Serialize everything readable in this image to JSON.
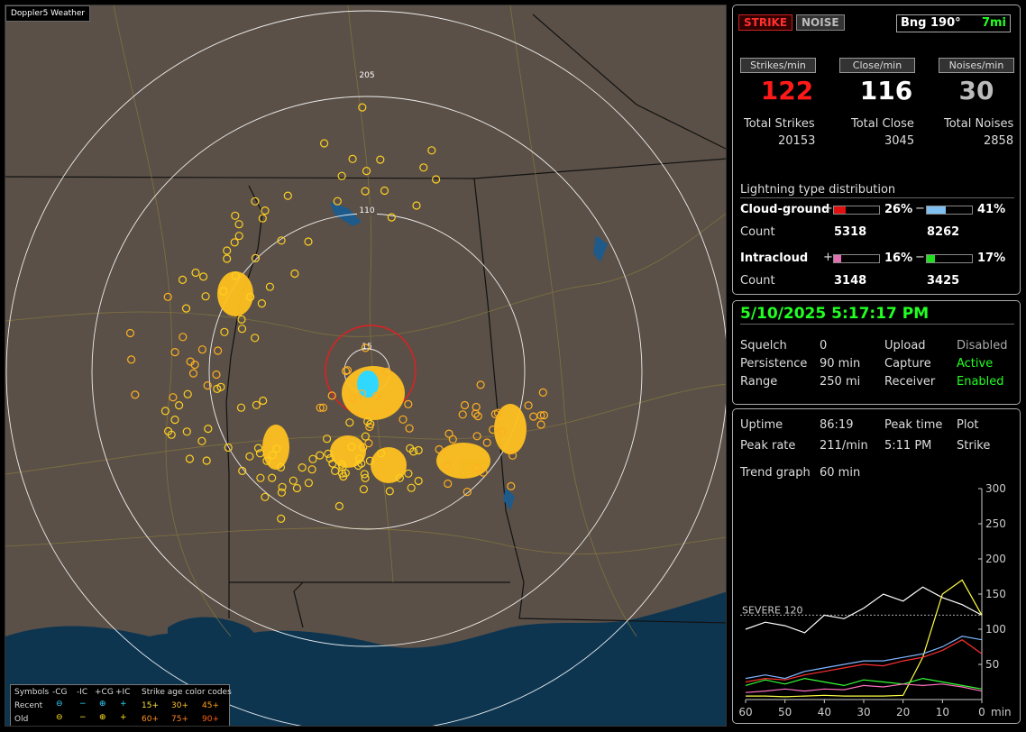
{
  "map": {
    "title": "Doppler5 Weather",
    "ring_labels": [
      "205",
      "110",
      "15"
    ],
    "legend": {
      "symbols_label": "Symbols",
      "cols": [
        "-CG",
        "-IC",
        "+CG",
        "+IC"
      ],
      "recent_label": "Recent",
      "old_label": "Old",
      "age_title": "Strike age color codes",
      "recent_ages": [
        "15+",
        "30+",
        "45+"
      ],
      "old_ages": [
        "60+",
        "75+",
        "90+"
      ]
    }
  },
  "status": {
    "strike_btn": "STRIKE",
    "noise_btn": "NOISE",
    "bearing": "Bng 190°",
    "distance": "7mi",
    "strikes_min_label": "Strikes/min",
    "close_min_label": "Close/min",
    "noises_min_label": "Noises/min",
    "strikes_min": "122",
    "close_min": "116",
    "noises_min": "30",
    "total_strikes_label": "Total Strikes",
    "total_close_label": "Total Close",
    "total_noises_label": "Total Noises",
    "total_strikes": "20153",
    "total_close": "3045",
    "total_noises": "2858",
    "dist_title": "Lightning type distribution",
    "cg_label": "Cloud-ground",
    "ic_label": "Intracloud",
    "count_label": "Count",
    "plus": "+",
    "minus": "−",
    "cg_pos_pct": "26%",
    "cg_neg_pct": "41%",
    "ic_pos_pct": "16%",
    "ic_neg_pct": "17%",
    "cg_pos_count": "5318",
    "cg_neg_count": "8262",
    "ic_pos_count": "3148",
    "ic_neg_count": "3425",
    "cg_pos_frac": 0.26,
    "cg_neg_frac": 0.41,
    "ic_pos_frac": 0.16,
    "ic_neg_frac": 0.17
  },
  "settings": {
    "datetime": "5/10/2025 5:17:17 PM",
    "squelch_label": "Squelch",
    "squelch": "0",
    "persistence_label": "Persistence",
    "persistence": "90 min",
    "range_label": "Range",
    "range": "250 mi",
    "upload_label": "Upload",
    "upload": "Disabled",
    "capture_label": "Capture",
    "capture": "Active",
    "receiver_label": "Receiver",
    "receiver": "Enabled"
  },
  "stats": {
    "uptime_label": "Uptime",
    "uptime": "86:19",
    "peak_time_label": "Peak time",
    "peak_time": "5:11 PM",
    "plot_label": "Plot",
    "plot": "Strike",
    "peak_rate_label": "Peak rate",
    "peak_rate": "211/min",
    "trend_label": "Trend graph",
    "trend_value": "60 min",
    "severe_label": "SEVERE 120"
  },
  "chart_data": {
    "type": "line",
    "x": [
      60,
      50,
      40,
      30,
      20,
      10,
      0
    ],
    "xlabel": "min",
    "ylim": [
      0,
      300
    ],
    "yticks": [
      50,
      100,
      150,
      200,
      250,
      300
    ],
    "severe": 120,
    "series": [
      {
        "color": "#ffffff",
        "values": [
          100,
          110,
          105,
          95,
          120,
          115,
          130,
          150,
          140,
          160,
          145,
          135,
          120
        ]
      },
      {
        "color": "#ffff44",
        "values": [
          5,
          5,
          4,
          5,
          6,
          5,
          5,
          5,
          6,
          60,
          150,
          170,
          120
        ]
      },
      {
        "color": "#7fb6ff",
        "values": [
          30,
          35,
          30,
          40,
          45,
          50,
          55,
          55,
          60,
          65,
          75,
          90,
          85
        ]
      },
      {
        "color": "#ff3030",
        "values": [
          25,
          30,
          28,
          35,
          40,
          45,
          50,
          48,
          55,
          60,
          70,
          85,
          65
        ]
      },
      {
        "color": "#33ff33",
        "values": [
          20,
          28,
          22,
          30,
          25,
          20,
          28,
          25,
          22,
          30,
          25,
          20,
          15
        ]
      },
      {
        "color": "#ff70c0",
        "values": [
          10,
          12,
          15,
          12,
          15,
          14,
          20,
          18,
          22,
          20,
          22,
          18,
          12
        ]
      }
    ]
  }
}
